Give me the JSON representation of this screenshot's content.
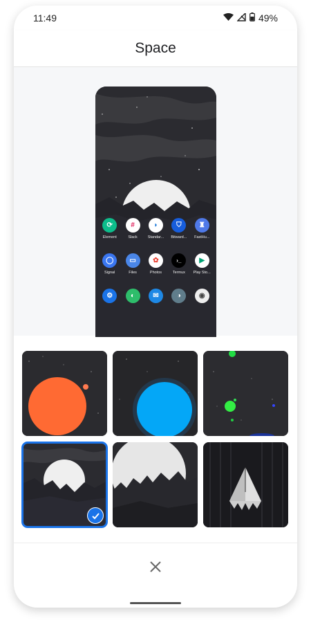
{
  "status": {
    "time": "11:49",
    "battery": "49%"
  },
  "header": {
    "title": "Space"
  },
  "apps": [
    [
      {
        "label": "Element",
        "color": "#0dbd8b",
        "glyph": "⟳"
      },
      {
        "label": "Slack",
        "color": "#ffffff",
        "glyph": "#"
      },
      {
        "label": "Standar...",
        "color": "#ffffff",
        "glyph": "◗"
      },
      {
        "label": "Bitward...",
        "color": "#175ddc",
        "glyph": "⛉"
      },
      {
        "label": "FastHu...",
        "color": "#4f79e8",
        "glyph": "♜"
      }
    ],
    [
      {
        "label": "Signal",
        "color": "#3a76f0",
        "glyph": "◯"
      },
      {
        "label": "Files",
        "color": "#4a86e8",
        "glyph": "▭"
      },
      {
        "label": "Photos",
        "color": "#ffffff",
        "glyph": "✿"
      },
      {
        "label": "Termux",
        "color": "#000000",
        "glyph": "›_"
      },
      {
        "label": "Play Sto...",
        "color": "#ffffff",
        "glyph": "▶"
      }
    ],
    [
      {
        "label": "",
        "color": "#1a73e8",
        "glyph": "⚙"
      },
      {
        "label": "",
        "color": "#2ebd6b",
        "glyph": "◐"
      },
      {
        "label": "",
        "color": "#1e88e5",
        "glyph": "✉"
      },
      {
        "label": "",
        "color": "#607d8b",
        "glyph": "◑"
      },
      {
        "label": "",
        "color": "#eeeeee",
        "glyph": "◉"
      }
    ]
  ],
  "wallpapers": [
    {
      "name": "red-planet"
    },
    {
      "name": "blue-planet"
    },
    {
      "name": "green-stars"
    },
    {
      "name": "space-mountains",
      "selected": true
    },
    {
      "name": "moon-mountains"
    },
    {
      "name": "crystal-ice"
    }
  ],
  "colors": {
    "accent": "#1a73e8"
  }
}
